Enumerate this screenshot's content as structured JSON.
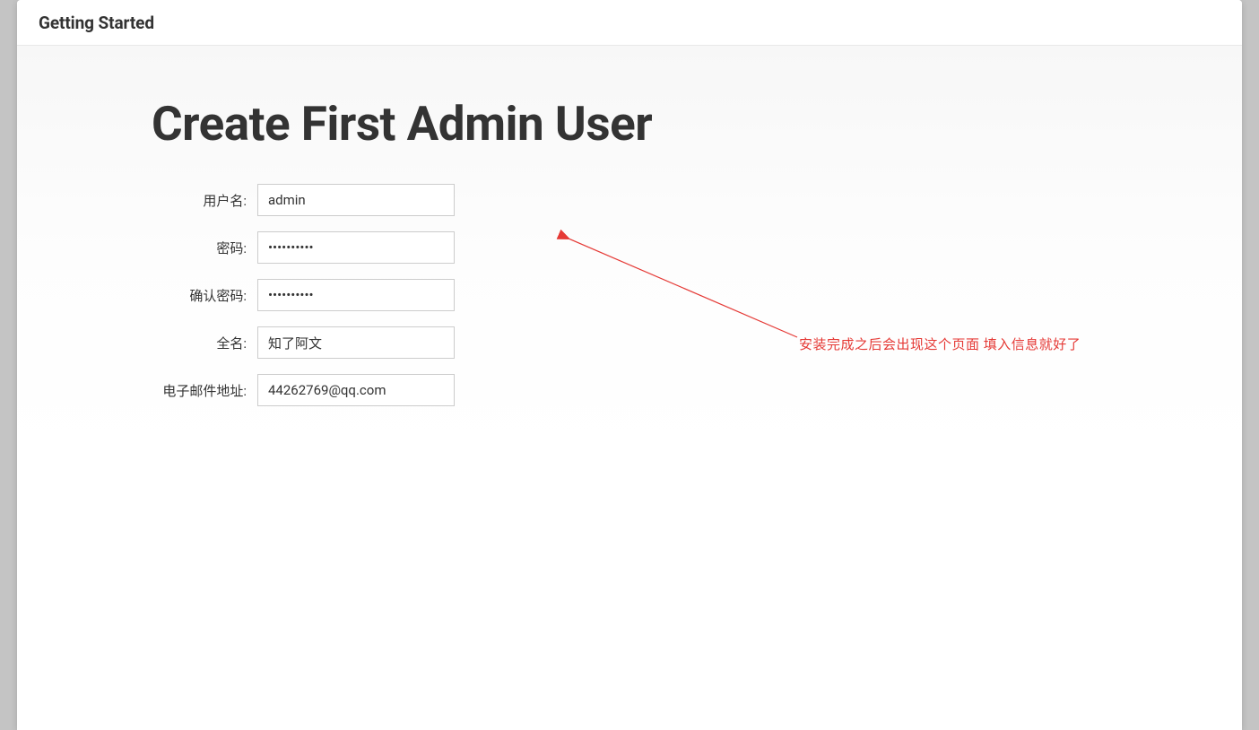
{
  "header": {
    "title": "Getting Started"
  },
  "main": {
    "title": "Create First Admin User"
  },
  "form": {
    "username": {
      "label": "用户名:",
      "value": "admin"
    },
    "password": {
      "label": "密码:",
      "value": "••••••••••"
    },
    "confirm_password": {
      "label": "确认密码:",
      "value": "••••••••••"
    },
    "fullname": {
      "label": "全名:",
      "value": "知了阿文"
    },
    "email": {
      "label": "电子邮件地址:",
      "value": "44262769@qq.com"
    }
  },
  "annotation": {
    "text": "安装完成之后会出现这个页面 填入信息就好了",
    "color": "#e53935"
  }
}
